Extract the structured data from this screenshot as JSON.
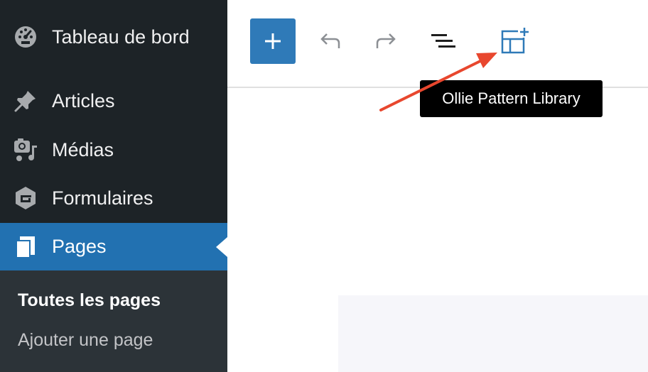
{
  "sidebar": {
    "items": [
      {
        "label": "Tableau de bord",
        "icon": "dashboard-icon"
      },
      {
        "label": "Articles",
        "icon": "pin-icon"
      },
      {
        "label": "Médias",
        "icon": "media-icon"
      },
      {
        "label": "Formulaires",
        "icon": "forms-icon"
      },
      {
        "label": "Pages",
        "icon": "pages-icon",
        "active": true
      }
    ],
    "submenu": [
      {
        "label": "Toutes les pages",
        "current": true
      },
      {
        "label": "Ajouter une page"
      }
    ]
  },
  "toolbar": {
    "buttons": [
      "add-block-icon",
      "undo-icon",
      "redo-icon",
      "list-view-icon",
      "pattern-library-icon"
    ],
    "tooltip": "Ollie Pattern Library"
  },
  "colors": {
    "sidebar_bg": "#1d2327",
    "active_bg": "#2271b1",
    "add_button": "#2f7ab8",
    "pattern_icon": "#2f7ab8",
    "annotation_arrow": "#e8472e"
  }
}
